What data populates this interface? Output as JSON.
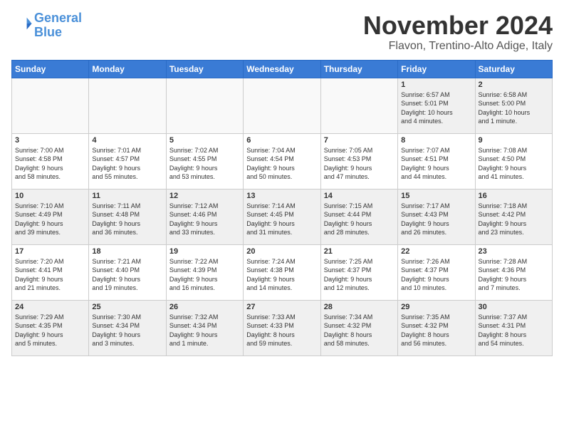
{
  "header": {
    "logo_line1": "General",
    "logo_line2": "Blue",
    "month_title": "November 2024",
    "location": "Flavon, Trentino-Alto Adige, Italy"
  },
  "days_of_week": [
    "Sunday",
    "Monday",
    "Tuesday",
    "Wednesday",
    "Thursday",
    "Friday",
    "Saturday"
  ],
  "weeks": [
    [
      {
        "day": "",
        "info": "",
        "empty": true
      },
      {
        "day": "",
        "info": "",
        "empty": true
      },
      {
        "day": "",
        "info": "",
        "empty": true
      },
      {
        "day": "",
        "info": "",
        "empty": true
      },
      {
        "day": "",
        "info": "",
        "empty": true
      },
      {
        "day": "1",
        "info": "Sunrise: 6:57 AM\nSunset: 5:01 PM\nDaylight: 10 hours\nand 4 minutes."
      },
      {
        "day": "2",
        "info": "Sunrise: 6:58 AM\nSunset: 5:00 PM\nDaylight: 10 hours\nand 1 minute."
      }
    ],
    [
      {
        "day": "3",
        "info": "Sunrise: 7:00 AM\nSunset: 4:58 PM\nDaylight: 9 hours\nand 58 minutes."
      },
      {
        "day": "4",
        "info": "Sunrise: 7:01 AM\nSunset: 4:57 PM\nDaylight: 9 hours\nand 55 minutes."
      },
      {
        "day": "5",
        "info": "Sunrise: 7:02 AM\nSunset: 4:55 PM\nDaylight: 9 hours\nand 53 minutes."
      },
      {
        "day": "6",
        "info": "Sunrise: 7:04 AM\nSunset: 4:54 PM\nDaylight: 9 hours\nand 50 minutes."
      },
      {
        "day": "7",
        "info": "Sunrise: 7:05 AM\nSunset: 4:53 PM\nDaylight: 9 hours\nand 47 minutes."
      },
      {
        "day": "8",
        "info": "Sunrise: 7:07 AM\nSunset: 4:51 PM\nDaylight: 9 hours\nand 44 minutes."
      },
      {
        "day": "9",
        "info": "Sunrise: 7:08 AM\nSunset: 4:50 PM\nDaylight: 9 hours\nand 41 minutes."
      }
    ],
    [
      {
        "day": "10",
        "info": "Sunrise: 7:10 AM\nSunset: 4:49 PM\nDaylight: 9 hours\nand 39 minutes."
      },
      {
        "day": "11",
        "info": "Sunrise: 7:11 AM\nSunset: 4:48 PM\nDaylight: 9 hours\nand 36 minutes."
      },
      {
        "day": "12",
        "info": "Sunrise: 7:12 AM\nSunset: 4:46 PM\nDaylight: 9 hours\nand 33 minutes."
      },
      {
        "day": "13",
        "info": "Sunrise: 7:14 AM\nSunset: 4:45 PM\nDaylight: 9 hours\nand 31 minutes."
      },
      {
        "day": "14",
        "info": "Sunrise: 7:15 AM\nSunset: 4:44 PM\nDaylight: 9 hours\nand 28 minutes."
      },
      {
        "day": "15",
        "info": "Sunrise: 7:17 AM\nSunset: 4:43 PM\nDaylight: 9 hours\nand 26 minutes."
      },
      {
        "day": "16",
        "info": "Sunrise: 7:18 AM\nSunset: 4:42 PM\nDaylight: 9 hours\nand 23 minutes."
      }
    ],
    [
      {
        "day": "17",
        "info": "Sunrise: 7:20 AM\nSunset: 4:41 PM\nDaylight: 9 hours\nand 21 minutes."
      },
      {
        "day": "18",
        "info": "Sunrise: 7:21 AM\nSunset: 4:40 PM\nDaylight: 9 hours\nand 19 minutes."
      },
      {
        "day": "19",
        "info": "Sunrise: 7:22 AM\nSunset: 4:39 PM\nDaylight: 9 hours\nand 16 minutes."
      },
      {
        "day": "20",
        "info": "Sunrise: 7:24 AM\nSunset: 4:38 PM\nDaylight: 9 hours\nand 14 minutes."
      },
      {
        "day": "21",
        "info": "Sunrise: 7:25 AM\nSunset: 4:37 PM\nDaylight: 9 hours\nand 12 minutes."
      },
      {
        "day": "22",
        "info": "Sunrise: 7:26 AM\nSunset: 4:37 PM\nDaylight: 9 hours\nand 10 minutes."
      },
      {
        "day": "23",
        "info": "Sunrise: 7:28 AM\nSunset: 4:36 PM\nDaylight: 9 hours\nand 7 minutes."
      }
    ],
    [
      {
        "day": "24",
        "info": "Sunrise: 7:29 AM\nSunset: 4:35 PM\nDaylight: 9 hours\nand 5 minutes."
      },
      {
        "day": "25",
        "info": "Sunrise: 7:30 AM\nSunset: 4:34 PM\nDaylight: 9 hours\nand 3 minutes."
      },
      {
        "day": "26",
        "info": "Sunrise: 7:32 AM\nSunset: 4:34 PM\nDaylight: 9 hours\nand 1 minute."
      },
      {
        "day": "27",
        "info": "Sunrise: 7:33 AM\nSunset: 4:33 PM\nDaylight: 8 hours\nand 59 minutes."
      },
      {
        "day": "28",
        "info": "Sunrise: 7:34 AM\nSunset: 4:32 PM\nDaylight: 8 hours\nand 58 minutes."
      },
      {
        "day": "29",
        "info": "Sunrise: 7:35 AM\nSunset: 4:32 PM\nDaylight: 8 hours\nand 56 minutes."
      },
      {
        "day": "30",
        "info": "Sunrise: 7:37 AM\nSunset: 4:31 PM\nDaylight: 8 hours\nand 54 minutes."
      }
    ]
  ]
}
